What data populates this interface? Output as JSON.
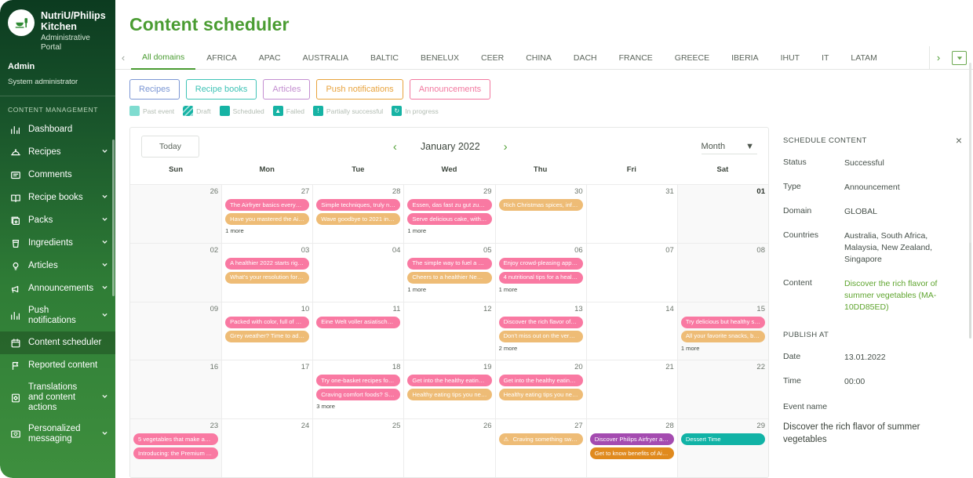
{
  "sidebar": {
    "brand_title": "NutriU/Philips Kitchen",
    "brand_sub": "Administrative Portal",
    "user_name": "Admin",
    "user_role": "System administrator",
    "section_label": "CONTENT MANAGEMENT",
    "items": [
      {
        "label": "Dashboard",
        "icon": "chart-icon",
        "expandable": false,
        "active": false
      },
      {
        "label": "Recipes",
        "icon": "recipe-dome-icon",
        "expandable": true,
        "active": false
      },
      {
        "label": "Comments",
        "icon": "comment-icon",
        "expandable": false,
        "active": false
      },
      {
        "label": "Recipe books",
        "icon": "book-icon",
        "expandable": true,
        "active": false
      },
      {
        "label": "Packs",
        "icon": "packs-icon",
        "expandable": true,
        "active": false
      },
      {
        "label": "Ingredients",
        "icon": "ingredients-icon",
        "expandable": true,
        "active": false
      },
      {
        "label": "Articles",
        "icon": "bulb-icon",
        "expandable": true,
        "active": false
      },
      {
        "label": "Announcements",
        "icon": "megaphone-icon",
        "expandable": true,
        "active": false
      },
      {
        "label": "Push notifications",
        "icon": "chart-icon",
        "expandable": true,
        "active": false
      },
      {
        "label": "Content scheduler",
        "icon": "calendar-icon",
        "expandable": false,
        "active": true
      },
      {
        "label": "Reported content",
        "icon": "flag-icon",
        "expandable": false,
        "active": false
      },
      {
        "label": "Translations and content actions",
        "icon": "translate-icon",
        "expandable": true,
        "active": false
      },
      {
        "label": "Personalized messaging",
        "icon": "message-heart-icon",
        "expandable": true,
        "active": false
      }
    ]
  },
  "header": {
    "title": "Content scheduler"
  },
  "domain_tabs": {
    "prev_label": "‹",
    "next_label": "›",
    "items": [
      "All domains",
      "AFRICA",
      "APAC",
      "AUSTRALIA",
      "BALTIC",
      "BENELUX",
      "CEER",
      "CHINA",
      "DACH",
      "FRANCE",
      "GREECE",
      "IBERIA",
      "IHUT",
      "IT",
      "LATAM"
    ],
    "active": "All domains"
  },
  "filters": [
    {
      "label": "Recipes",
      "color": "#7b96d4"
    },
    {
      "label": "Recipe books",
      "color": "#3fc3b6"
    },
    {
      "label": "Articles",
      "color": "#c38ed0"
    },
    {
      "label": "Push notifications",
      "color": "#e8a33d"
    },
    {
      "label": "Announcements",
      "color": "#f2789f"
    }
  ],
  "legend": [
    {
      "label": "Past event",
      "swatch": "#7fdcd0",
      "style": "solid",
      "glyph": ""
    },
    {
      "label": "Draft",
      "swatch": "#16b3a4",
      "style": "hatch",
      "glyph": ""
    },
    {
      "label": "Scheduled",
      "swatch": "#16b3a4",
      "style": "solid",
      "glyph": ""
    },
    {
      "label": "Failed",
      "swatch": "#16b3a4",
      "style": "solid",
      "glyph": "▲"
    },
    {
      "label": "Partially successful",
      "swatch": "#16b3a4",
      "style": "solid",
      "glyph": "!"
    },
    {
      "label": "In progress",
      "swatch": "#16b3a4",
      "style": "solid",
      "glyph": "↻"
    }
  ],
  "calendar": {
    "today_label": "Today",
    "prev_label": "‹",
    "next_label": "›",
    "month_label": "January 2022",
    "view_label": "Month",
    "dow": [
      "Sun",
      "Mon",
      "Tue",
      "Wed",
      "Thu",
      "Fri",
      "Sat"
    ],
    "weeks": [
      [
        {
          "num": "26",
          "out": true,
          "events": [],
          "more": ""
        },
        {
          "num": "27",
          "out": false,
          "more": "1 more",
          "events": [
            {
              "text": "The Airfryer basics everyone...",
              "color": "#f979a2"
            },
            {
              "text": "Have you mastered the Airfr...",
              "color": "#eebc76"
            }
          ]
        },
        {
          "num": "28",
          "out": false,
          "more": "",
          "events": [
            {
              "text": "Simple techniques, truly nex...",
              "color": "#f979a2"
            },
            {
              "text": "Wave goodbye to 2021 in st...",
              "color": "#eebc76"
            }
          ]
        },
        {
          "num": "29",
          "out": false,
          "more": "1 more",
          "events": [
            {
              "text": "Essen, das fast zu gut zum E...",
              "color": "#f979a2"
            },
            {
              "text": "Serve delicious cake, with a ...",
              "color": "#f979a2"
            }
          ]
        },
        {
          "num": "30",
          "out": false,
          "more": "",
          "events": [
            {
              "text": "Rich Christmas spices, infus...",
              "color": "#eebc76"
            }
          ]
        },
        {
          "num": "31",
          "out": false,
          "more": "",
          "events": []
        },
        {
          "num": "01",
          "out": true,
          "bold": true,
          "more": "",
          "events": []
        }
      ],
      [
        {
          "num": "02",
          "out": true,
          "events": [],
          "more": ""
        },
        {
          "num": "03",
          "out": false,
          "more": "",
          "events": [
            {
              "text": "A healthier 2022 starts right ...",
              "color": "#f979a2"
            },
            {
              "text": "What's your resolution for 2...",
              "color": "#eebc76"
            }
          ]
        },
        {
          "num": "04",
          "out": false,
          "more": "",
          "events": []
        },
        {
          "num": "05",
          "out": false,
          "more": "1 more",
          "events": [
            {
              "text": "The simple way to fuel a hea...",
              "color": "#f979a2"
            },
            {
              "text": "Cheers to a healthier New Y...",
              "color": "#eebc76"
            }
          ]
        },
        {
          "num": "06",
          "out": false,
          "more": "1 more",
          "events": [
            {
              "text": "Enjoy crowd-pleasing appet...",
              "color": "#f979a2"
            },
            {
              "text": "4 nutritional tips for a health...",
              "color": "#f979a2"
            }
          ]
        },
        {
          "num": "07",
          "out": false,
          "more": "",
          "events": []
        },
        {
          "num": "08",
          "out": true,
          "more": "",
          "events": []
        }
      ],
      [
        {
          "num": "09",
          "out": true,
          "events": [],
          "more": ""
        },
        {
          "num": "10",
          "out": false,
          "more": "",
          "events": [
            {
              "text": "Packed with color, full of nut...",
              "color": "#f979a2"
            },
            {
              "text": "Grey weather? Time to add ...",
              "color": "#eebc76"
            }
          ]
        },
        {
          "num": "11",
          "out": false,
          "more": "",
          "events": [
            {
              "text": "Eine Welt voller asiatischer ...",
              "color": "#f979a2"
            }
          ]
        },
        {
          "num": "12",
          "out": false,
          "more": "",
          "events": []
        },
        {
          "num": "13",
          "out": false,
          "more": "2 more",
          "events": [
            {
              "text": "Discover the rich flavor of su...",
              "color": "#f979a2"
            },
            {
              "text": "Don't miss out on the very b...",
              "color": "#eebc76"
            }
          ]
        },
        {
          "num": "14",
          "out": false,
          "more": "",
          "events": []
        },
        {
          "num": "15",
          "out": true,
          "more": "1 more",
          "events": [
            {
              "text": "Try delicious but healthy sna...",
              "color": "#f979a2"
            },
            {
              "text": "All your favorite snacks, but ...",
              "color": "#eebc76"
            }
          ]
        }
      ],
      [
        {
          "num": "16",
          "out": true,
          "events": [],
          "more": ""
        },
        {
          "num": "17",
          "out": false,
          "more": "",
          "events": []
        },
        {
          "num": "18",
          "out": false,
          "more": "3 more",
          "events": [
            {
              "text": "Try one-basket recipes for e...",
              "color": "#f979a2"
            },
            {
              "text": "Craving comfort foods? Swit...",
              "color": "#f979a2"
            }
          ]
        },
        {
          "num": "19",
          "out": false,
          "more": "",
          "events": [
            {
              "text": "Get into the healthy eating h...",
              "color": "#f979a2"
            },
            {
              "text": "Healthy eating tips you nee...",
              "color": "#eebc76"
            }
          ]
        },
        {
          "num": "20",
          "out": false,
          "more": "",
          "events": [
            {
              "text": "Get into the healthy eating h...",
              "color": "#f979a2"
            },
            {
              "text": "Healthy eating tips you nee...",
              "color": "#eebc76"
            }
          ]
        },
        {
          "num": "21",
          "out": false,
          "more": "",
          "events": []
        },
        {
          "num": "22",
          "out": true,
          "more": "",
          "events": []
        }
      ],
      [
        {
          "num": "23",
          "out": true,
          "more": "",
          "events": [
            {
              "text": "5 vegetables that make awe...",
              "color": "#f979a2"
            },
            {
              "text": "Introducing: the Premium Ai...",
              "color": "#f979a2"
            }
          ]
        },
        {
          "num": "24",
          "out": false,
          "more": "",
          "events": []
        },
        {
          "num": "25",
          "out": false,
          "more": "",
          "events": []
        },
        {
          "num": "26",
          "out": false,
          "more": "",
          "events": []
        },
        {
          "num": "27",
          "out": false,
          "more": "",
          "events": [
            {
              "text": "Craving something swee...",
              "color": "#eebc76",
              "warn": "⚠"
            }
          ]
        },
        {
          "num": "28",
          "out": false,
          "more": "",
          "events": [
            {
              "text": "Discover Philips Airfryer acc...",
              "color": "#a44bb0",
              "hatch": true
            },
            {
              "text": "Get to know benefits of Air S...",
              "color": "#e08a1e",
              "hatch": true
            }
          ]
        },
        {
          "num": "29",
          "out": true,
          "more": "",
          "events": [
            {
              "text": "Dessert Time",
              "color": "#11b3a6",
              "hatch": true
            }
          ]
        }
      ]
    ]
  },
  "panel": {
    "title": "SCHEDULE CONTENT",
    "close_label": "×",
    "rows": [
      {
        "key": "Status",
        "value": "Successful",
        "green": false
      },
      {
        "key": "Type",
        "value": "Announcement",
        "green": false
      },
      {
        "key": "Domain",
        "value": "GLOBAL",
        "green": false
      },
      {
        "key": "Countries",
        "value": "Australia, South Africa, Malaysia, New Zealand, Singapore",
        "green": false
      },
      {
        "key": "Content",
        "value": "Discover the rich flavor of summer vegetables (MA-10DD85ED)",
        "green": true
      }
    ],
    "publish_label": "PUBLISH AT",
    "publish_rows": [
      {
        "key": "Date",
        "value": "13.01.2022"
      },
      {
        "key": "Time",
        "value": "00:00"
      }
    ],
    "event_name_label": "Event name",
    "event_name_value": "Discover the rich flavor of summer vegetables"
  }
}
